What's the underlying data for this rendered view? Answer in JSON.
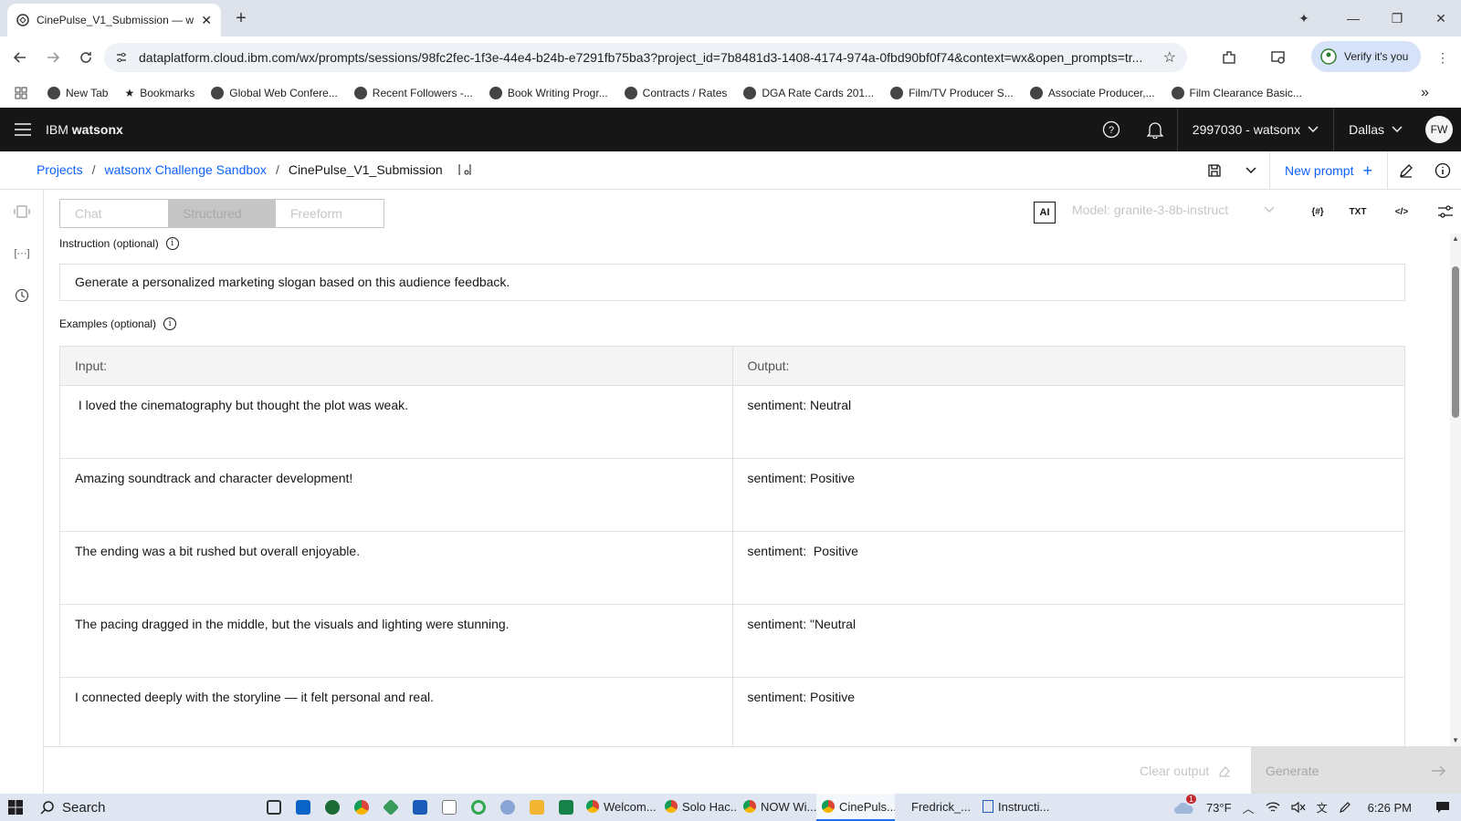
{
  "browser": {
    "tab_title": "CinePulse_V1_Submission — w",
    "url": "dataplatform.cloud.ibm.com/wx/prompts/sessions/98fc2fec-1f3e-44e4-b24b-e7291fb75ba3?project_id=7b8481d3-1408-4174-974a-0fbd90bf0f74&context=wx&open_prompts=tr...",
    "verify_label": "Verify it's you",
    "bookmarks": [
      "New Tab",
      "Bookmarks",
      "Global Web Confere...",
      "Recent Followers -...",
      "Book Writing Progr...",
      "Contracts / Rates",
      "DGA Rate Cards 201...",
      "Film/TV Producer S...",
      "Associate Producer,...",
      "Film Clearance Basic..."
    ]
  },
  "app": {
    "brand_prefix": "IBM ",
    "brand_name": "watsonx",
    "account": "2997030 - watsonx",
    "region": "Dallas",
    "avatar_initials": "FW"
  },
  "breadcrumb": {
    "projects": "Projects",
    "sandbox": "watsonx Challenge Sandbox",
    "current": "CinePulse_V1_Submission",
    "new_prompt": "New prompt"
  },
  "modes": {
    "chat": "Chat",
    "structured": "Structured",
    "freeform": "Freeform",
    "selected": "Structured"
  },
  "model": {
    "ai_badge": "AI",
    "label": "Model: granite-3-8b-instruct",
    "txt_icon": "TXT"
  },
  "instruction": {
    "label": "Instruction (optional)",
    "value": "Generate a personalized marketing slogan based on this audience feedback."
  },
  "examples": {
    "label": "Examples (optional)",
    "input_header": "Input:",
    "output_header": "Output:",
    "rows": [
      {
        "input": " I loved the cinematography but thought the plot was weak.",
        "output": "sentiment: Neutral"
      },
      {
        "input": "Amazing soundtrack and character development!",
        "output": "sentiment: Positive"
      },
      {
        "input": "The ending was a bit rushed but overall enjoyable.",
        "output": "sentiment:  Positive"
      },
      {
        "input": "The pacing dragged in the middle, but the visuals and lighting were stunning.",
        "output": "sentiment: \"Neutral"
      },
      {
        "input": "I connected deeply with the storyline — it felt personal and real.",
        "output": "sentiment: Positive"
      }
    ]
  },
  "footer": {
    "clear_output": "Clear output",
    "generate": "Generate"
  },
  "taskbar": {
    "search": "Search",
    "apps": [
      "Welcom...",
      "Solo Hac...",
      "NOW Wi...",
      "CinePuls...",
      "Fredrick_...",
      "Instructi..."
    ],
    "active_app": "CinePuls...",
    "weather": "73°F",
    "weather_badge": "1",
    "time": "6:26 PM"
  },
  "colors": {
    "link": "#0f62fe",
    "header_bg": "#161616",
    "taskbar_bg": "#dfe6f1"
  }
}
